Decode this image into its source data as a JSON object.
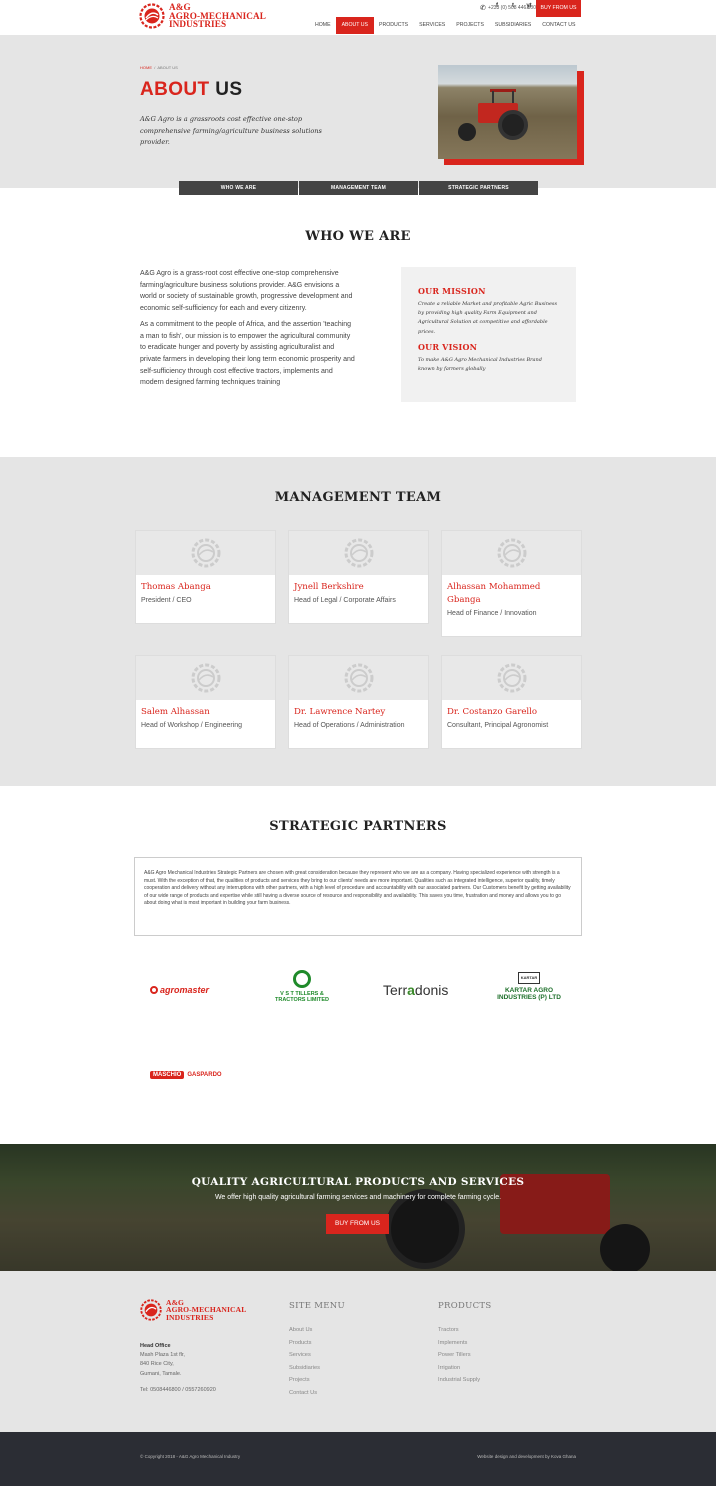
{
  "brand": {
    "logo_line1": "A&G",
    "logo_line2": "AGRO-MECHANICAL",
    "logo_line3": "INDUSTRIES",
    "accent_color": "#d9251d"
  },
  "topbar": {
    "phone": "+233 (0) 508 446 800",
    "social": [
      "f",
      "t",
      "yt"
    ],
    "buy_label": "BUY FROM US"
  },
  "nav": {
    "items": [
      "HOME",
      "ABOUT US",
      "PRODUCTS",
      "SERVICES",
      "PROJECTS",
      "SUBSIDIARIES",
      "CONTACT US"
    ],
    "active": "ABOUT US"
  },
  "hero": {
    "breadcrumb_home": "HOME",
    "breadcrumb_sep": "/",
    "breadcrumb_current": "ABOUT US",
    "title_red": "ABOUT",
    "title_dark": "US",
    "text": "A&G Agro is a grassroots cost effective one-stop comprehensive farming/agriculture business solutions provider."
  },
  "tabs": [
    "WHO WE ARE",
    "MANAGEMENT TEAM",
    "STRATEGIC PARTNERS"
  ],
  "who": {
    "title": "WHO WE ARE",
    "p1": "A&G Agro is a grass-root cost effective one-stop comprehensive farming/agriculture business solutions provider. A&G envisions a world or society of sustainable growth, progressive development and economic self-sufficiency for each and every citizenry.",
    "p2": "As a commitment to the people of Africa, and the assertion 'teaching a man to fish', our mission is to empower the agricultural community to eradicate hunger and poverty by assisting agriculturalist and private farmers in developing their long term economic prosperity and self-sufficiency through cost effective tractors, implements and modern designed farming techniques training",
    "mission_title": "OUR MISSION",
    "mission_text": "Create a reliable Market and profitable Agric Business by providing high quality Farm Equipment and Agricultural Solution at competitive and affordable prices.",
    "vision_title": "OUR VISION",
    "vision_text": "To make A&G Agro Mechanical Industries Brand known by farmers globally"
  },
  "team": {
    "title": "MANAGEMENT TEAM",
    "members": [
      {
        "name": "Thomas Abanga",
        "role": "President / CEO"
      },
      {
        "name": "Jynell Berkshire",
        "role": "Head of Legal / Corporate Affairs"
      },
      {
        "name": "Alhassan Mohammed Gbanga",
        "role": "Head of Finance / Innovation"
      },
      {
        "name": "Salem Alhassan",
        "role": "Head of Workshop / Engineering"
      },
      {
        "name": "Dr. Lawrence Nartey",
        "role": "Head of Operations / Administration"
      },
      {
        "name": "Dr. Costanzo Garello",
        "role": "Consultant, Principal Agronomist"
      }
    ]
  },
  "partners": {
    "title": "STRATEGIC PARTNERS",
    "text": "A&G Agro Mechanical Industries Strategic Partners are chosen with great consideration because they represent who we are as a company. Having specialized experience with strength is a must. With the exception of that, the qualities of products and services they bring to our clients' needs are more important. Qualities such as integrated intelligence, superior quality, timely cooperation and delivery without any interruptions with other partners, with a high level of procedure and accountability with our associated partners. Our Customers benefit by getting availability of our wide range of products and expertise while still having a diverse source of resource and responsibility and availability. This saves you time, frustration and money and allows you to go about doing what is most important in building your farm business.",
    "logos": {
      "agromaster": "agromaster",
      "vst_line1": "V S T TILLERS &",
      "vst_line2": "TRACTORS LIMITED",
      "terra_a": "Terr",
      "terra_b": "a",
      "terra_c": "donis",
      "kartar_badge": "KARTAR",
      "kartar_line1": "KARTAR AGRO",
      "kartar_line2": "INDUSTRIES (P) LTD",
      "maschio": "MASCHIO",
      "gaspardo": "GASPARDO"
    }
  },
  "cta": {
    "title": "QUALITY AGRICULTURAL PRODUCTS AND SERVICES",
    "text": "We offer high quality agricultural farming services and machinery for complete farming cycle.",
    "button": "BUY FROM US"
  },
  "footer": {
    "office_label": "Head Office",
    "address": [
      "Mash Plaza 1st flr,",
      "840 Rice City,",
      "Gumani, Tamale."
    ],
    "tel": "Tel: 0508446800 / 0557260920",
    "site_menu_title": "SITE MENU",
    "site_menu": [
      "About Us",
      "Products",
      "Services",
      "Subsidiaries",
      "Projects",
      "Contact Us"
    ],
    "products_title": "PRODUCTS",
    "products": [
      "Tractors",
      "Implements",
      "Power Tillers",
      "Irrigation",
      "Industrial Supply"
    ],
    "copyright": "© Copyright 2018 - A&G Agro Mechanical Industry",
    "credit": "Website design and development by Kova Ghana"
  }
}
